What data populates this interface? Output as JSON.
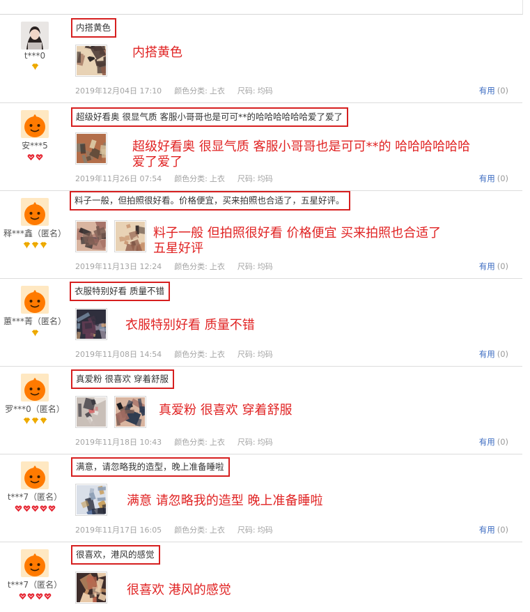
{
  "labels": {
    "color_category": "颜色分类:",
    "size": "尺码:",
    "helpful": "有用",
    "helpful_count": "(0)"
  },
  "colors": {
    "annotation": "#e02222",
    "box_border": "#d61f1f",
    "link": "#3b6bc1",
    "meta": "#a3a3a3",
    "badge": "#f5b800",
    "heart": "#e5232f"
  },
  "reviews": [
    {
      "user": "t***0",
      "avatar": "photo-avatar",
      "badge_type": "diamond",
      "badge_count": 1,
      "comment": "内搭黄色",
      "annotation_lines": [
        "内搭黄色"
      ],
      "photos": 1,
      "date": "2019年12月04日 17:10",
      "color_value": "上衣",
      "size_value": "均码"
    },
    {
      "user": "安***5",
      "avatar": "orange-mascot-avatar",
      "badge_type": "heart",
      "badge_count": 2,
      "comment": "超级好看奥 很显气质 客服小哥哥也是可可**的哈哈哈哈哈哈爱了爱了",
      "annotation_lines": [
        "超级好看奥  很显气质  客服小哥哥也是可可**的   哈哈哈哈哈哈",
        "爱了爱了"
      ],
      "photos": 1,
      "date": "2019年11月26日 07:54",
      "color_value": "上衣",
      "size_value": "均码"
    },
    {
      "user": "释***鑫（匿名）",
      "avatar": "orange-mascot-avatar",
      "badge_type": "diamond",
      "badge_count": 3,
      "comment": "料子一般，但拍照很好看。价格便宜，买来拍照也合适了，五星好评。",
      "annotation_lines": [
        "料子一般    但拍照很好看     价格便宜     买来拍照也合适了",
        "五星好评"
      ],
      "photos": 2,
      "date": "2019年11月13日 12:24",
      "color_value": "上衣",
      "size_value": "均码"
    },
    {
      "user": "蕙***菁（匿名）",
      "avatar": "orange-mascot-avatar",
      "badge_type": "diamond",
      "badge_count": 1,
      "comment": "衣服特别好看 质量不错",
      "annotation_lines": [
        "衣服特别好看   质量不错"
      ],
      "photos": 1,
      "date": "2019年11月08日 14:54",
      "color_value": "上衣",
      "size_value": "均码"
    },
    {
      "user": "罗***0（匿名）",
      "avatar": "orange-mascot-avatar",
      "badge_type": "diamond",
      "badge_count": 3,
      "comment": "真爱粉 很喜欢 穿着舒服",
      "annotation_lines": [
        "真爱粉   很喜欢   穿着舒服"
      ],
      "photos": 2,
      "date": "2019年11月18日 10:43",
      "color_value": "上衣",
      "size_value": "均码"
    },
    {
      "user": "t***7（匿名）",
      "avatar": "orange-mascot-avatar",
      "badge_type": "heart",
      "badge_count": 5,
      "comment": "满意，请忽略我的造型，晚上准备睡啦",
      "annotation_lines": [
        "满意    请忽略我的造型    晚上准备睡啦"
      ],
      "photos": 1,
      "date": "2019年11月17日 16:05",
      "color_value": "上衣",
      "size_value": "均码"
    },
    {
      "user": "t***7（匿名）",
      "avatar": "orange-mascot-avatar",
      "badge_type": "heart",
      "badge_count": 4,
      "comment": "很喜欢，港风的感觉",
      "annotation_lines": [
        "很喜欢    港风的感觉"
      ],
      "photos": 1,
      "date": "",
      "color_value": "",
      "size_value": ""
    }
  ]
}
